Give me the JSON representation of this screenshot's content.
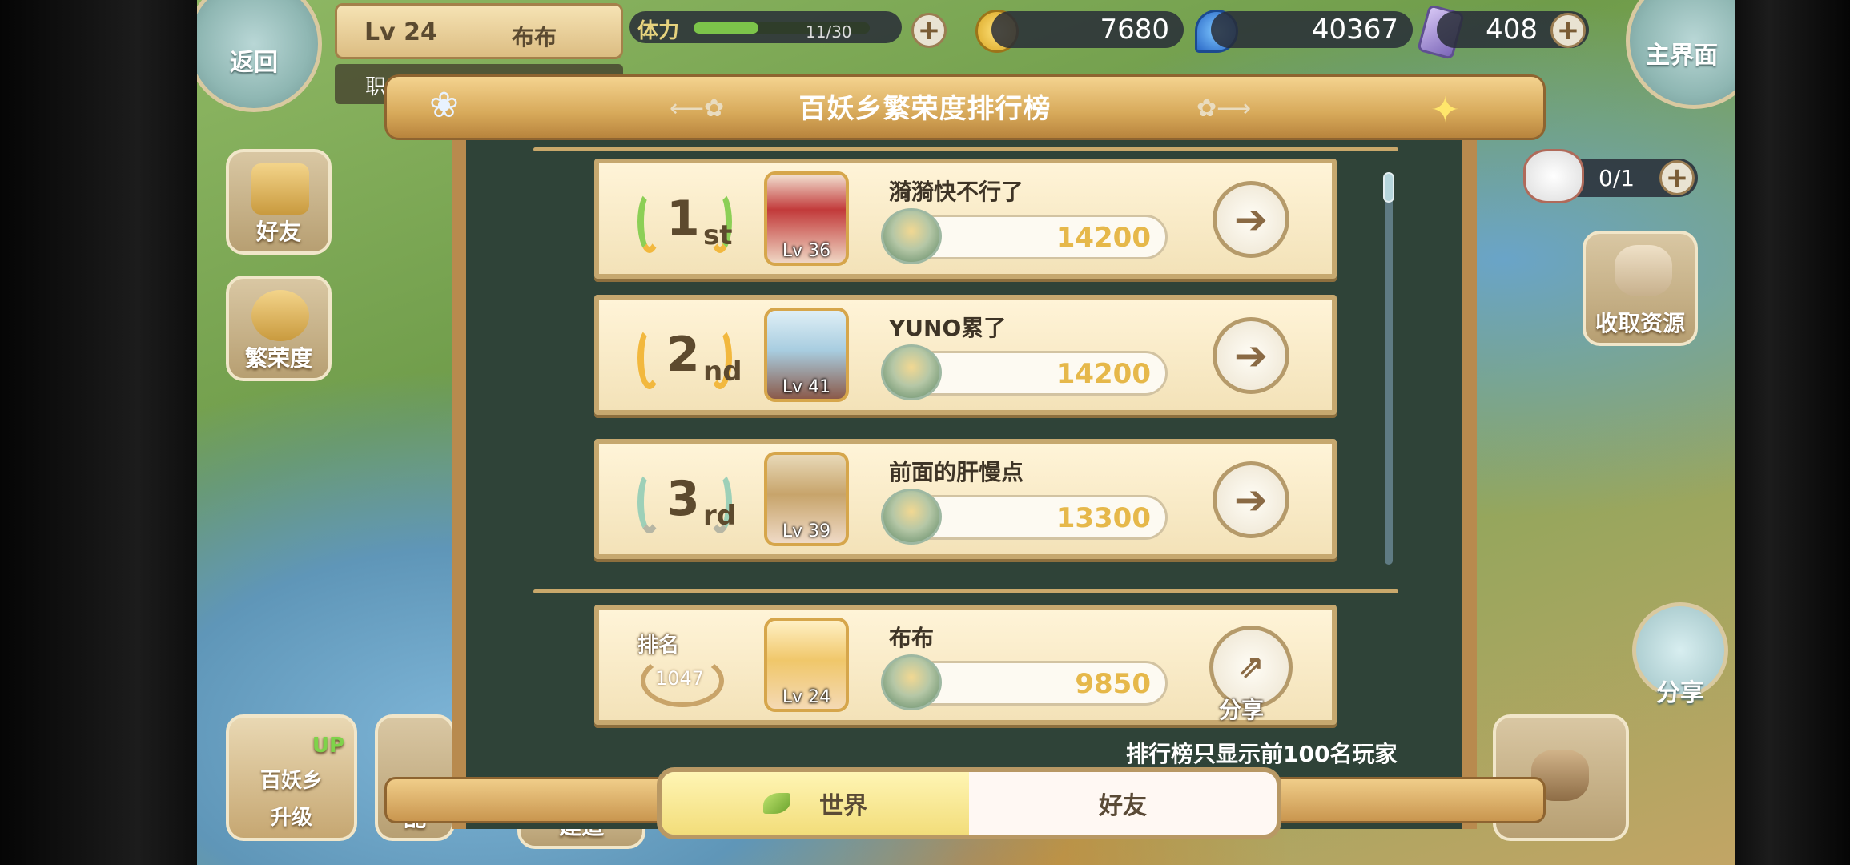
{
  "top_bar": {
    "back_label": "返回",
    "level": "Lv 24",
    "player_name": "布布",
    "stamina_label": "体力",
    "stamina_value": "11/30",
    "stamina_fraction": 0.37,
    "academy_label": "职业技术学院",
    "gold": "7680",
    "blue_gem": "40367",
    "crystal": "408",
    "main_label": "主界面"
  },
  "left_menu": {
    "friends": "好友",
    "prosperity": "繁荣度"
  },
  "right_menu": {
    "capacity": "0/1",
    "collect": "收取资源",
    "share": "分享"
  },
  "bottom_bar": {
    "upgrade_top": "百妖乡",
    "upgrade_bottom": "升级",
    "upgrade_badge": "UP",
    "config": "配",
    "build": "建造"
  },
  "panel": {
    "title": "百妖乡繁荣度排行榜",
    "rows": [
      {
        "rank": "1",
        "suffix": "st",
        "name": "漪漪快不行了",
        "level": "Lv 36",
        "score": "14200"
      },
      {
        "rank": "2",
        "suffix": "nd",
        "name": "YUNO累了",
        "level": "Lv 41",
        "score": "14200"
      },
      {
        "rank": "3",
        "suffix": "rd",
        "name": "前面的肝慢点",
        "level": "Lv 39",
        "score": "13300"
      }
    ],
    "self_row": {
      "rank_label": "排名",
      "rank": "1047",
      "name": "布布",
      "level": "Lv 24",
      "score": "9850",
      "share_label": "分享"
    },
    "note": "排行榜只显示前100名玩家",
    "tabs": {
      "world": "世界",
      "friends": "好友"
    }
  }
}
